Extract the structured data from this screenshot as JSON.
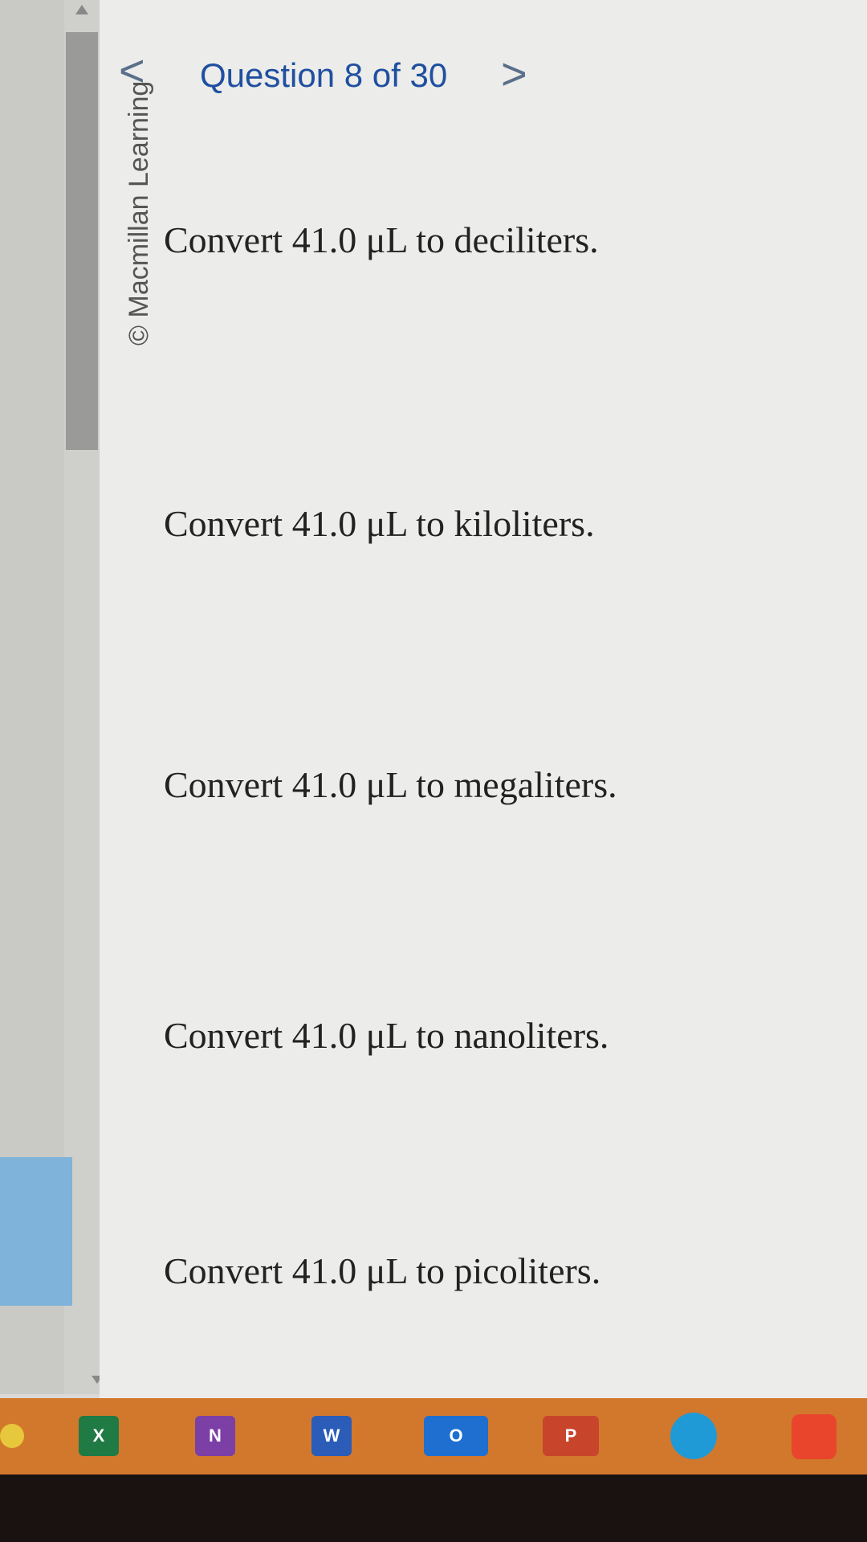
{
  "header": {
    "prev_glyph": "<",
    "title": "Question 8 of 30",
    "next_glyph": ">"
  },
  "copyright": "© Macmillan Learning",
  "questions": [
    "Convert 41.0 μL to deciliters.",
    "Convert 41.0 μL to kiloliters.",
    "Convert 41.0 μL to megaliters.",
    "Convert 41.0 μL to nanoliters.",
    "Convert 41.0 μL to picoliters."
  ],
  "taskbar": {
    "excel_letter": "X",
    "onenote_letter": "N",
    "word_letter": "W",
    "outlook_letter": "O",
    "powerpoint_letter": "P"
  }
}
